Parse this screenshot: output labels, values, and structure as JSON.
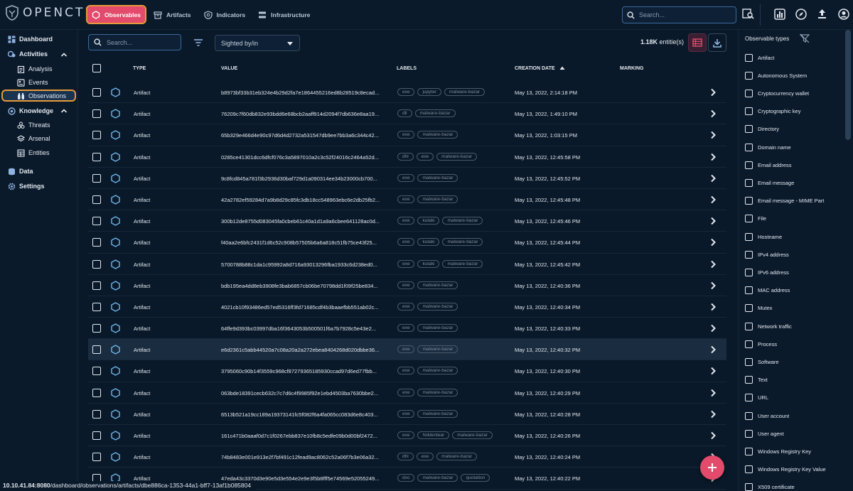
{
  "app": {
    "name": "OPENCTI"
  },
  "topnav": [
    {
      "label": "Observables",
      "active": true
    },
    {
      "label": "Artifacts",
      "active": false
    },
    {
      "label": "Indicators",
      "active": false
    },
    {
      "label": "Infrastructure",
      "active": false
    }
  ],
  "top_search": {
    "placeholder": "Search..."
  },
  "sidebar": {
    "dashboard": "Dashboard",
    "activities": "Activities",
    "analysis": "Analysis",
    "events": "Events",
    "observations": "Observations",
    "knowledge": "Knowledge",
    "threats": "Threats",
    "arsenal": "Arsenal",
    "entities": "Entities",
    "data": "Data",
    "settings": "Settings"
  },
  "toolbar": {
    "search_placeholder": "Search...",
    "select_value": "Sighted by/in",
    "entities_count": "1.18K",
    "entities_suffix": " entitie(s)"
  },
  "table": {
    "headers": {
      "type": "TYPE",
      "value": "VALUE",
      "labels": "LABELS",
      "creation_date": "CREATION DATE",
      "marking": "MARKING"
    },
    "rows": [
      {
        "type": "Artifact",
        "value": "b8973bf33b31eb324e4b29d2fa7e1864455216ed8b28519c8ecad...",
        "labels": [
          "exe",
          "jupyter",
          "malware-bazar"
        ],
        "date": "May 13, 2022, 2:14:18 PM"
      },
      {
        "type": "Artifact",
        "value": "76209c7f60db832e93bdd6e68bcb2aaff914d2094f7db636e8aa19...",
        "labels": [
          "dll",
          "malware-bazar"
        ],
        "date": "May 13, 2022, 1:49:10 PM"
      },
      {
        "type": "Artifact",
        "value": "65b329e466d4e90c97d6d4d2732a531547db9ee7bb3a6c344c42...",
        "labels": [
          "exe",
          "malware-bazar"
        ],
        "date": "May 13, 2022, 1:03:15 PM"
      },
      {
        "type": "Artifact",
        "value": "0285ce41301dcc6dfcf076c3a5897010a2c3c52f24016c2464a52d...",
        "labels": [
          "dhl",
          "exe",
          "malware-bazar"
        ],
        "date": "May 13, 2022, 12:45:58 PM"
      },
      {
        "type": "Artifact",
        "value": "9c8fcd845a781f3b2936d30baf729d1a090314ee34b23000cb700...",
        "labels": [
          "exe",
          "malware-bazar"
        ],
        "date": "May 13, 2022, 12:45:52 PM"
      },
      {
        "type": "Artifact",
        "value": "42a2782ef59284d7a9b8d29c85fc3db18cc548963ebc6e2db25fb2...",
        "labels": [
          "exe",
          "malware-bazar"
        ],
        "date": "May 13, 2022, 12:45:48 PM"
      },
      {
        "type": "Artifact",
        "value": "300b12de8755d083045fa0cbeb61c40a1d1a9a6cbee641128ac0d...",
        "labels": [
          "exe",
          "kutaki",
          "malware-bazar"
        ],
        "date": "May 13, 2022, 12:45:46 PM"
      },
      {
        "type": "Artifact",
        "value": "f40aa2e6bfc2431f1d6c52c908b57505b6a6a818c51fb75ce43f25...",
        "labels": [
          "exe",
          "kutaki",
          "malware-bazar"
        ],
        "date": "May 13, 2022, 12:45:44 PM"
      },
      {
        "type": "Artifact",
        "value": "5700788b88c1da1c95992a8d716a93013296fba1933c6d238ed0...",
        "labels": [
          "exe",
          "kutaki",
          "malware-bazar"
        ],
        "date": "May 13, 2022, 12:45:42 PM"
      },
      {
        "type": "Artifact",
        "value": "bdb195ea4dd8eb3908fe3bab6857cb06be70798dd1f09f25be834...",
        "labels": [
          "exe",
          "malware-bazar"
        ],
        "date": "May 13, 2022, 12:40:36 PM"
      },
      {
        "type": "Artifact",
        "value": "4021cb10f93486ed57ed5316ff3fd71685cdf4b3baaefbb551ab02c...",
        "labels": [
          "exe",
          "malware-bazar"
        ],
        "date": "May 13, 2022, 12:40:34 PM"
      },
      {
        "type": "Artifact",
        "value": "64ffe9d393bc03997dba16f3643053b500501f6a7b7928c5e43e2...",
        "labels": [
          "exe",
          "malware-bazar"
        ],
        "date": "May 13, 2022, 12:40:33 PM"
      },
      {
        "type": "Artifact",
        "value": "e6d2361c5abb44520a7c08a20a2a272ebea8404268d020dbbe36...",
        "labels": [
          "exe",
          "malware-bazar"
        ],
        "date": "May 13, 2022, 12:40:32 PM"
      },
      {
        "type": "Artifact",
        "value": "3795060c90b14f3559c968cf87279365185930ccad97d6ed77fbb...",
        "labels": [
          "exe",
          "malware-bazar"
        ],
        "date": "May 13, 2022, 12:40:30 PM"
      },
      {
        "type": "Artifact",
        "value": "063bde18391cecb632c7c7d6c4f9985f92e1ebd4503ba7630bbe2...",
        "labels": [
          "exe",
          "malware-bazar"
        ],
        "date": "May 13, 2022, 12:40:29 PM"
      },
      {
        "type": "Artifact",
        "value": "6513b521a19cc189a19373141fc5f082f6a4fa065cc083d6e8c403...",
        "labels": [
          "exe",
          "malware-bazar"
        ],
        "date": "May 13, 2022, 12:40:28 PM"
      },
      {
        "type": "Artifact",
        "value": "161c471b0aaaf0d7c1f0267ebb837e10fb8c5edfe09b0d00bf2472...",
        "labels": [
          "exe",
          "hiddentear",
          "malware-bazar"
        ],
        "date": "May 13, 2022, 12:40:26 PM"
      },
      {
        "type": "Artifact",
        "value": "74b8483e001e913e2f7bf491c12fead9ac8062c52a06f7b3e06a32...",
        "labels": [
          "dhl",
          "exe",
          "malware-bazar"
        ],
        "date": "May 13, 2022, 12:40:24 PM"
      },
      {
        "type": "Artifact",
        "value": "47eda43c3370d3e90e5d3e554e2e9e3f5b8fff5e74569e52055249...",
        "labels": [
          "doc",
          "malware-bazar",
          "quotation"
        ],
        "date": "May 13, 2022, 12:40:22 PM"
      }
    ]
  },
  "right_panel": {
    "title": "Observable types",
    "items": [
      "Artifact",
      "Autonomous System",
      "Cryptocurrency wallet",
      "Cryptographic key",
      "Directory",
      "Domain name",
      "Email address",
      "Email message",
      "Email message - MIME Part",
      "File",
      "Hostname",
      "IPv4 address",
      "IPv6 address",
      "MAC address",
      "Mutex",
      "Network traffic",
      "Process",
      "Software",
      "Text",
      "URL",
      "User account",
      "User agent",
      "Windows Registry Key",
      "Windows Registry Key Value",
      "X509 certificate"
    ]
  },
  "status_bar": {
    "host": "10.10.41.84:8080",
    "path": "/dashboard/observations/artifacts/dbe886ca-1353-44a1-bff7-13af1b085804"
  },
  "colors": {
    "accent": "#e24b6b",
    "highlight": "#e69a3a",
    "background": "#0a1929"
  }
}
